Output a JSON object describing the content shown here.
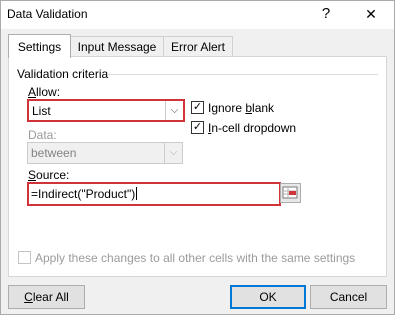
{
  "window": {
    "title": "Data Validation",
    "help": "?",
    "close": "✕"
  },
  "tabs": [
    {
      "label": "Settings",
      "active": true
    },
    {
      "label": "Input Message",
      "active": false
    },
    {
      "label": "Error Alert",
      "active": false
    }
  ],
  "criteria": {
    "group_label": "Validation criteria",
    "allow": {
      "label_pre": "",
      "label_ul": "A",
      "label_post": "llow:",
      "value": "List"
    },
    "data": {
      "label": "Data:",
      "value": "between"
    },
    "ignore_blank": {
      "label_pre": "Ignore ",
      "label_ul": "b",
      "label_post": "lank",
      "checked": true
    },
    "incell_dropdown": {
      "label_pre": "",
      "label_ul": "I",
      "label_post": "n-cell dropdown",
      "checked": true
    },
    "source": {
      "label_pre": "",
      "label_ul": "S",
      "label_post": "ource:",
      "value": "=Indirect(\"Product\")"
    }
  },
  "apply_all": {
    "label": "Apply these changes to all other cells with the same settings",
    "checked": false
  },
  "buttons": {
    "clear_all_ul": "C",
    "clear_all_rest": "lear All",
    "ok": "OK",
    "cancel": "Cancel"
  },
  "colors": {
    "highlight": "#d13438",
    "accent": "#0078d7"
  },
  "icons": {
    "range": "range-select-icon",
    "dropdown": "chevron-down-icon"
  }
}
